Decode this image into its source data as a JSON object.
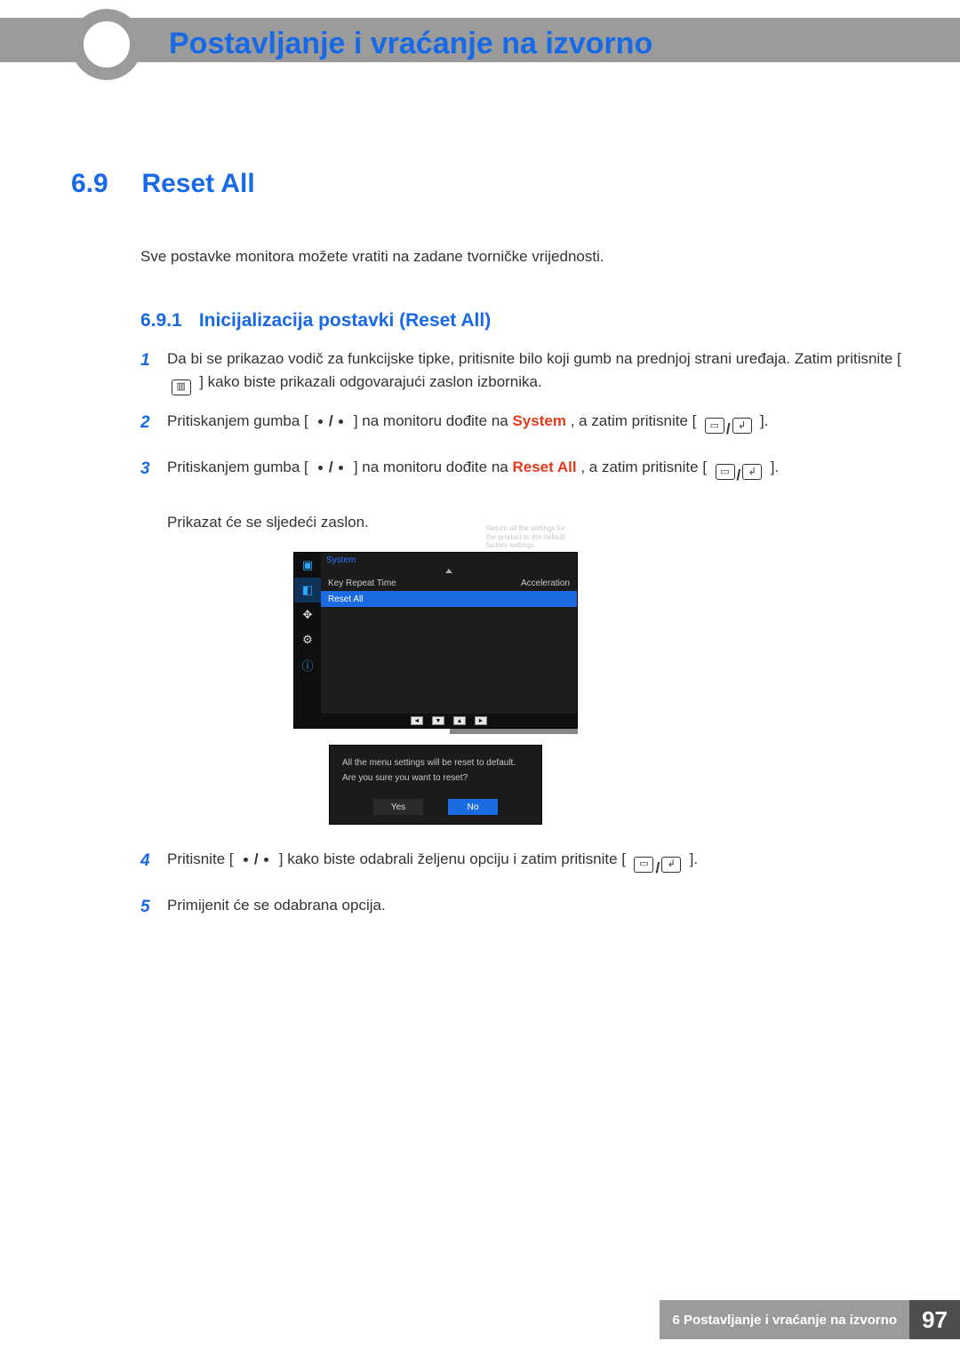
{
  "header": {
    "chapter_title": "Postavljanje i vraćanje na izvorno"
  },
  "section": {
    "number": "6.9",
    "title": "Reset All",
    "intro": "Sve postavke monitora možete vratiti na zadane tvorničke vrijednosti."
  },
  "subsection": {
    "number": "6.9.1",
    "title": "Inicijalizacija postavki (Reset All)"
  },
  "steps": {
    "s1_a": "Da bi se prikazao vodič za funkcijske tipke, pritisnite bilo koji gumb na prednjoj strani uređaja. Zatim pritisnite [",
    "s1_b": "] kako biste prikazali odgovarajući zaslon izbornika.",
    "s2_a": "Pritiskanjem gumba [",
    "s2_mid": "] na monitoru dođite na ",
    "s2_kw": "System",
    "s2_b": ", a zatim pritisnite [",
    "s2_c": "].",
    "s3_a": "Pritiskanjem gumba [",
    "s3_mid": "] na monitoru dođite na ",
    "s3_kw": "Reset All",
    "s3_b": ", a zatim pritisnite [",
    "s3_c": "].",
    "s3_follow": "Prikazat će se sljedeći zaslon.",
    "s4_a": "Pritisnite [",
    "s4_mid": "] kako biste odabrali željenu opciju i zatim pritisnite [",
    "s4_b": "].",
    "s5": "Primijenit će se odabrana opcija."
  },
  "osd": {
    "title": "System",
    "help": "Return all the settings for the product to the default factory settings.",
    "row1_label": "Key Repeat Time",
    "row1_value": "Acceleration",
    "row2_label": "Reset All",
    "nav": [
      "◄",
      "▼",
      "▲",
      "►"
    ]
  },
  "dialog": {
    "line1": "All the menu settings will be reset to default.",
    "line2": "Are you sure you want to reset?",
    "yes": "Yes",
    "no": "No"
  },
  "footer": {
    "label": "6 Postavljanje i vraćanje na izvorno",
    "page": "97"
  }
}
